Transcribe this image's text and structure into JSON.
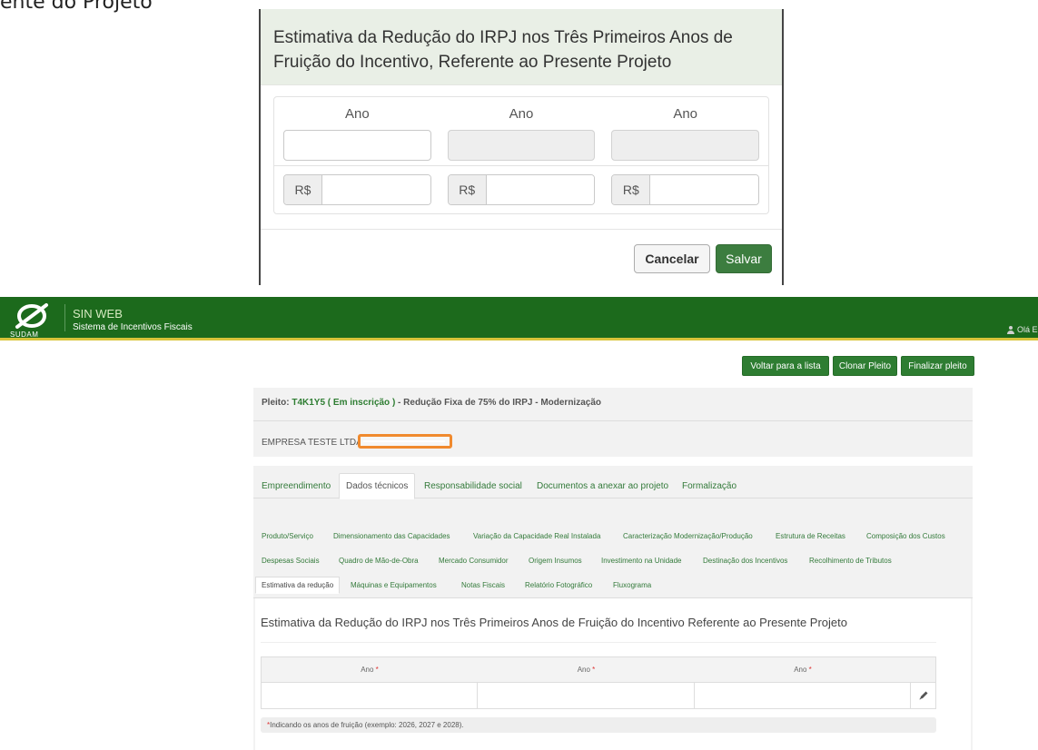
{
  "doc_fragment": "ente do Projeto",
  "modal": {
    "title": "Estimativa da Redução do IRPJ nos Três Primeiros Anos de Fruição do Incentivo, Referente ao Presente Projeto",
    "year_label": "Ano",
    "currency_prefix": "R$",
    "cancel_label": "Cancelar",
    "save_label": "Salvar"
  },
  "navbar": {
    "logo_text": "SUDAM",
    "app_name": "SIN WEB",
    "app_subtitle": "Sistema de Incentivos Fiscais",
    "user_greeting": "Olá E"
  },
  "actions": {
    "back_label": "Voltar para a lista",
    "clone_label": "Clonar Pleito",
    "finalize_label": "Finalizar pleito"
  },
  "pleito": {
    "prefix": "Pleito: ",
    "code": "T4K1Y5",
    "status": " ( Em inscrição )",
    "description": " - Redução Fixa de 75% do IRPJ - Modernização",
    "company": "EMPRESA TESTE LTDA -"
  },
  "main_tabs": [
    "Empreendimento",
    "Dados técnicos",
    "Responsabilidade social",
    "Documentos a anexar ao projeto",
    "Formalização"
  ],
  "sub_tabs_row1": [
    "Produto/Serviço",
    "Dimensionamento das Capacidades",
    "Variação da Capacidade Real Instalada",
    "Caracterização Modernização/Produção",
    "Estrutura de Receitas",
    "Composição dos Custos"
  ],
  "sub_tabs_row2": [
    "Despesas Sociais",
    "Quadro de Mão-de-Obra",
    "Mercado Consumidor",
    "Origem Insumos",
    "Investimento na Unidade",
    "Destinação dos Incentivos",
    "Recolhimento de Tributos"
  ],
  "sub_tabs_row3": [
    "Estimativa da redução",
    "Máquinas e Equipamentos",
    "Notas Fiscais",
    "Relatório Fotográfico",
    "Fluxograma"
  ],
  "content": {
    "title": "Estimativa da Redução do IRPJ nos Três Primeiros Anos de Fruição do Incentivo Referente ao Presente Projeto",
    "column_header": "Ano",
    "required_mark": "*",
    "note_mark": "*",
    "note_text": " Indicando os anos de fruição (exemplo: 2026, 2027 e 2028)."
  },
  "icons": {
    "logo": "sudam-logo-icon",
    "user": "user-icon",
    "edit": "pencil-icon"
  },
  "colors": {
    "navbar": "#1c6a1c",
    "accent_green": "#2e7d32",
    "navbar_border": "#d8c43a",
    "redaction": "#f08a2e"
  }
}
